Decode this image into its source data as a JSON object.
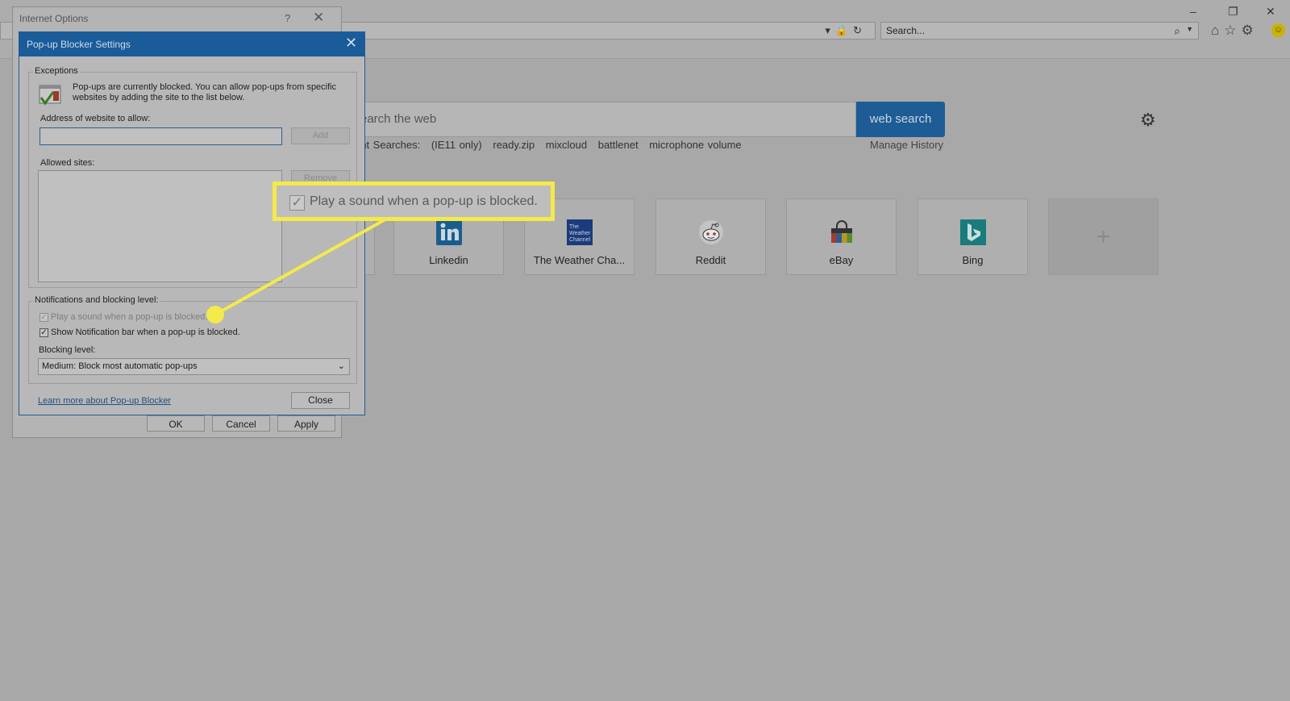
{
  "browser": {
    "search_placeholder": "Search...",
    "window_controls": {
      "minimize": "–",
      "restore": "❐",
      "close": "✕"
    }
  },
  "newtab": {
    "search_placeholder": "earch the web",
    "search_button": "web search",
    "recent_label": "ent Searches:",
    "recent_items": [
      "(IE11 only)",
      "ready.zip",
      "mixcloud",
      "battlenet",
      "microphone volume"
    ],
    "manage_history": "Manage History",
    "tiles": [
      {
        "label": "Linkedin",
        "icon": "linkedin-logo",
        "color": "#1a5d8c"
      },
      {
        "label": "The Weather Cha...",
        "icon": "weather-channel-logo",
        "color": "#1b3b7a"
      },
      {
        "label": "Reddit",
        "icon": "reddit-logo",
        "color": "#d7d7d7"
      },
      {
        "label": "eBay",
        "icon": "ebay-logo",
        "color": "#333333"
      },
      {
        "label": "Bing",
        "icon": "bing-logo",
        "color": "#1a7b7b"
      }
    ],
    "add_tile_symbol": "+"
  },
  "internet_options": {
    "title": "Internet Options",
    "help": "?",
    "close": "✕",
    "buttons": {
      "ok": "OK",
      "cancel": "Cancel",
      "apply": "Apply"
    }
  },
  "popup_blocker": {
    "title": "Pop-up Blocker Settings",
    "close": "✕",
    "exceptions_label": "Exceptions",
    "info_text": "Pop-ups are currently blocked.  You can allow pop-ups from specific websites by adding the site to the list below.",
    "address_label": "Address of website to allow:",
    "address_value": "",
    "add_button": "Add",
    "allowed_label": "Allowed sites:",
    "remove_button": "Remove",
    "notifications_label": "Notifications and blocking level:",
    "play_sound_label": "Play a sound when a pop-up is blocked.",
    "play_sound_checked": true,
    "notification_bar_label": "Show Notification bar when a pop-up is blocked.",
    "notification_bar_checked": true,
    "blocking_level_label": "Blocking level:",
    "blocking_level_value": "Medium: Block most automatic pop-ups",
    "learn_more": "Learn more about Pop-up Blocker",
    "close_button": "Close"
  },
  "callout": {
    "text": "Play a sound when a pop-up is blocked.",
    "color": "#f4ea4a"
  }
}
